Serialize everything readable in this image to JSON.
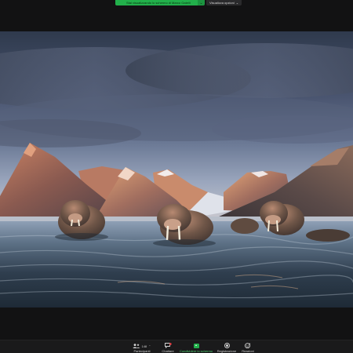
{
  "share_banner": {
    "status_text": "Stai visualizzando lo schermo di Marco Gatelli",
    "chevron_icon": "chevron-down-icon",
    "view_options_label": "Visualizza opzioni",
    "accent_color": "#22b04b"
  },
  "shared_screen": {
    "content": "photo",
    "icon": "walrus-photo"
  },
  "toolbar": {
    "participants": {
      "label": "Partecipanti",
      "count": "148",
      "icon": "participants-icon"
    },
    "chat": {
      "label": "Chattare",
      "icon": "chat-icon",
      "badge_color": "#e0383e"
    },
    "share": {
      "label": "Condividere lo schermo",
      "icon": "share-screen-icon"
    },
    "record": {
      "label": "Registrazione",
      "icon": "record-icon"
    },
    "reactions": {
      "label": "Reazioni",
      "icon": "reactions-icon"
    }
  }
}
